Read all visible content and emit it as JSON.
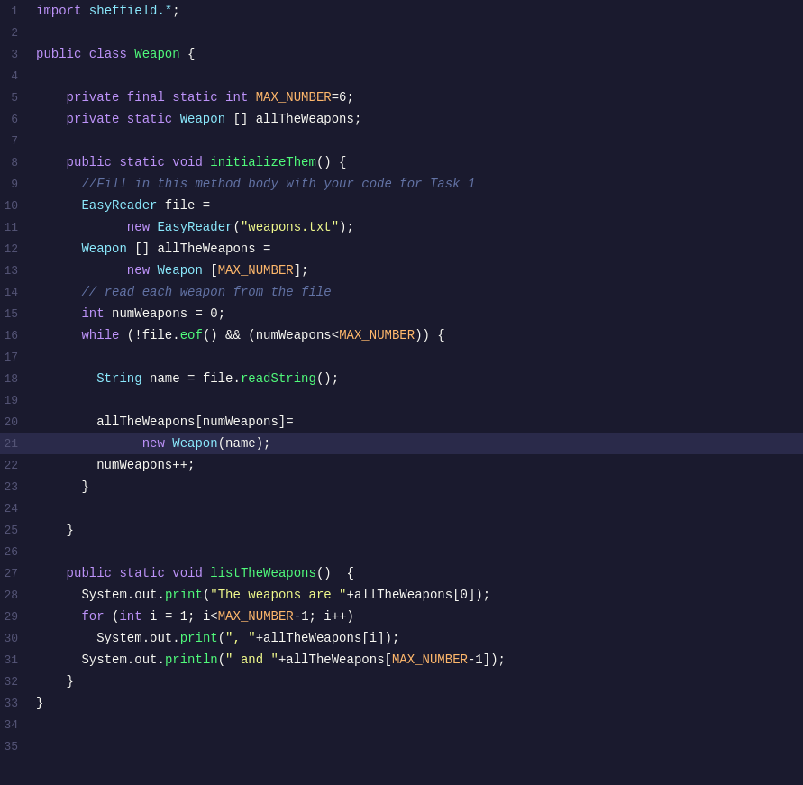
{
  "editor": {
    "background": "#1a1a2e",
    "highlighted_line": 21,
    "lines": [
      {
        "num": 1,
        "tokens": [
          {
            "t": "kw",
            "v": "import"
          },
          {
            "t": "plain",
            "v": " "
          },
          {
            "t": "import-pkg",
            "v": "sheffield.*"
          },
          {
            "t": "plain",
            "v": ";"
          }
        ]
      },
      {
        "num": 2,
        "tokens": []
      },
      {
        "num": 3,
        "tokens": [
          {
            "t": "kw",
            "v": "public"
          },
          {
            "t": "plain",
            "v": " "
          },
          {
            "t": "kw",
            "v": "class"
          },
          {
            "t": "plain",
            "v": " "
          },
          {
            "t": "classname",
            "v": "Weapon"
          },
          {
            "t": "plain",
            "v": " {"
          }
        ]
      },
      {
        "num": 4,
        "tokens": []
      },
      {
        "num": 5,
        "tokens": [
          {
            "t": "plain",
            "v": "    "
          },
          {
            "t": "kw",
            "v": "private"
          },
          {
            "t": "plain",
            "v": " "
          },
          {
            "t": "kw",
            "v": "final"
          },
          {
            "t": "plain",
            "v": " "
          },
          {
            "t": "kw",
            "v": "static"
          },
          {
            "t": "plain",
            "v": " "
          },
          {
            "t": "kw",
            "v": "int"
          },
          {
            "t": "plain",
            "v": " "
          },
          {
            "t": "param",
            "v": "MAX_NUMBER"
          },
          {
            "t": "plain",
            "v": "=6;"
          }
        ]
      },
      {
        "num": 6,
        "tokens": [
          {
            "t": "plain",
            "v": "    "
          },
          {
            "t": "kw",
            "v": "private"
          },
          {
            "t": "plain",
            "v": " "
          },
          {
            "t": "kw",
            "v": "static"
          },
          {
            "t": "plain",
            "v": " "
          },
          {
            "t": "type",
            "v": "Weapon"
          },
          {
            "t": "plain",
            "v": " [] "
          },
          {
            "t": "var",
            "v": "allTheWeapons"
          },
          {
            "t": "plain",
            "v": ";"
          }
        ]
      },
      {
        "num": 7,
        "tokens": []
      },
      {
        "num": 8,
        "tokens": [
          {
            "t": "plain",
            "v": "    "
          },
          {
            "t": "kw",
            "v": "public"
          },
          {
            "t": "plain",
            "v": " "
          },
          {
            "t": "kw",
            "v": "static"
          },
          {
            "t": "plain",
            "v": " "
          },
          {
            "t": "kw",
            "v": "void"
          },
          {
            "t": "plain",
            "v": " "
          },
          {
            "t": "method",
            "v": "initializeThem"
          },
          {
            "t": "plain",
            "v": "() {"
          }
        ]
      },
      {
        "num": 9,
        "tokens": [
          {
            "t": "plain",
            "v": "      "
          },
          {
            "t": "comment",
            "v": "//Fill in this method body with your code for Task 1"
          }
        ]
      },
      {
        "num": 10,
        "tokens": [
          {
            "t": "plain",
            "v": "      "
          },
          {
            "t": "type",
            "v": "EasyReader"
          },
          {
            "t": "plain",
            "v": " "
          },
          {
            "t": "var",
            "v": "file"
          },
          {
            "t": "plain",
            "v": " ="
          }
        ]
      },
      {
        "num": 11,
        "tokens": [
          {
            "t": "plain",
            "v": "            "
          },
          {
            "t": "kw",
            "v": "new"
          },
          {
            "t": "plain",
            "v": " "
          },
          {
            "t": "type",
            "v": "EasyReader"
          },
          {
            "t": "plain",
            "v": "("
          },
          {
            "t": "string",
            "v": "\"weapons.txt\""
          },
          {
            "t": "plain",
            "v": ");"
          }
        ]
      },
      {
        "num": 12,
        "tokens": [
          {
            "t": "plain",
            "v": "      "
          },
          {
            "t": "type",
            "v": "Weapon"
          },
          {
            "t": "plain",
            "v": " [] "
          },
          {
            "t": "var",
            "v": "allTheWeapons"
          },
          {
            "t": "plain",
            "v": " ="
          }
        ]
      },
      {
        "num": 13,
        "tokens": [
          {
            "t": "plain",
            "v": "            "
          },
          {
            "t": "kw",
            "v": "new"
          },
          {
            "t": "plain",
            "v": " "
          },
          {
            "t": "type",
            "v": "Weapon"
          },
          {
            "t": "plain",
            "v": " ["
          },
          {
            "t": "param",
            "v": "MAX_NUMBER"
          },
          {
            "t": "plain",
            "v": "];"
          }
        ]
      },
      {
        "num": 14,
        "tokens": [
          {
            "t": "plain",
            "v": "      "
          },
          {
            "t": "comment",
            "v": "// read each weapon from the file"
          }
        ]
      },
      {
        "num": 15,
        "tokens": [
          {
            "t": "plain",
            "v": "      "
          },
          {
            "t": "kw",
            "v": "int"
          },
          {
            "t": "plain",
            "v": " "
          },
          {
            "t": "var",
            "v": "numWeapons"
          },
          {
            "t": "plain",
            "v": " = 0;"
          }
        ]
      },
      {
        "num": 16,
        "tokens": [
          {
            "t": "plain",
            "v": "      "
          },
          {
            "t": "kw",
            "v": "while"
          },
          {
            "t": "plain",
            "v": " (!"
          },
          {
            "t": "var",
            "v": "file"
          },
          {
            "t": "plain",
            "v": "."
          },
          {
            "t": "method",
            "v": "eof"
          },
          {
            "t": "plain",
            "v": "() && ("
          },
          {
            "t": "var",
            "v": "numWeapons"
          },
          {
            "t": "plain",
            "v": "<"
          },
          {
            "t": "param",
            "v": "MAX_NUMBER"
          },
          {
            "t": "plain",
            "v": ")) {"
          }
        ]
      },
      {
        "num": 17,
        "tokens": []
      },
      {
        "num": 18,
        "tokens": [
          {
            "t": "plain",
            "v": "        "
          },
          {
            "t": "type",
            "v": "String"
          },
          {
            "t": "plain",
            "v": " "
          },
          {
            "t": "var",
            "v": "name"
          },
          {
            "t": "plain",
            "v": " = "
          },
          {
            "t": "var",
            "v": "file"
          },
          {
            "t": "plain",
            "v": "."
          },
          {
            "t": "method",
            "v": "readString"
          },
          {
            "t": "plain",
            "v": "();"
          }
        ]
      },
      {
        "num": 19,
        "tokens": []
      },
      {
        "num": 20,
        "tokens": [
          {
            "t": "plain",
            "v": "        "
          },
          {
            "t": "var",
            "v": "allTheWeapons"
          },
          {
            "t": "plain",
            "v": "["
          },
          {
            "t": "var",
            "v": "numWeapons"
          },
          {
            "t": "plain",
            "v": "]="
          }
        ]
      },
      {
        "num": 21,
        "tokens": [
          {
            "t": "plain",
            "v": "              "
          },
          {
            "t": "kw",
            "v": "new"
          },
          {
            "t": "plain",
            "v": " "
          },
          {
            "t": "type",
            "v": "Weapon"
          },
          {
            "t": "plain",
            "v": "("
          },
          {
            "t": "var",
            "v": "name"
          },
          {
            "t": "plain",
            "v": ");"
          }
        ],
        "highlighted": true
      },
      {
        "num": 22,
        "tokens": [
          {
            "t": "plain",
            "v": "        "
          },
          {
            "t": "var",
            "v": "numWeapons"
          },
          {
            "t": "plain",
            "v": "++;"
          }
        ]
      },
      {
        "num": 23,
        "tokens": [
          {
            "t": "plain",
            "v": "      }"
          }
        ]
      },
      {
        "num": 24,
        "tokens": []
      },
      {
        "num": 25,
        "tokens": [
          {
            "t": "plain",
            "v": "    }"
          }
        ]
      },
      {
        "num": 26,
        "tokens": []
      },
      {
        "num": 27,
        "tokens": [
          {
            "t": "plain",
            "v": "    "
          },
          {
            "t": "kw",
            "v": "public"
          },
          {
            "t": "plain",
            "v": " "
          },
          {
            "t": "kw",
            "v": "static"
          },
          {
            "t": "plain",
            "v": " "
          },
          {
            "t": "kw",
            "v": "void"
          },
          {
            "t": "plain",
            "v": " "
          },
          {
            "t": "method",
            "v": "listTheWeapons"
          },
          {
            "t": "plain",
            "v": "()  {"
          }
        ]
      },
      {
        "num": 28,
        "tokens": [
          {
            "t": "plain",
            "v": "      "
          },
          {
            "t": "var",
            "v": "System"
          },
          {
            "t": "plain",
            "v": "."
          },
          {
            "t": "var",
            "v": "out"
          },
          {
            "t": "plain",
            "v": "."
          },
          {
            "t": "method",
            "v": "print"
          },
          {
            "t": "plain",
            "v": "("
          },
          {
            "t": "string",
            "v": "\"The weapons are \""
          },
          {
            "t": "plain",
            "v": "+"
          },
          {
            "t": "var",
            "v": "allTheWeapons"
          },
          {
            "t": "plain",
            "v": "[0]);"
          }
        ]
      },
      {
        "num": 29,
        "tokens": [
          {
            "t": "plain",
            "v": "      "
          },
          {
            "t": "kw",
            "v": "for"
          },
          {
            "t": "plain",
            "v": " ("
          },
          {
            "t": "kw",
            "v": "int"
          },
          {
            "t": "plain",
            "v": " "
          },
          {
            "t": "var",
            "v": "i"
          },
          {
            "t": "plain",
            "v": " = 1; "
          },
          {
            "t": "var",
            "v": "i"
          },
          {
            "t": "plain",
            "v": "<"
          },
          {
            "t": "param",
            "v": "MAX_NUMBER"
          },
          {
            "t": "plain",
            "v": "-1; "
          },
          {
            "t": "var",
            "v": "i"
          },
          {
            "t": "plain",
            "v": "++)"
          }
        ]
      },
      {
        "num": 30,
        "tokens": [
          {
            "t": "plain",
            "v": "        "
          },
          {
            "t": "var",
            "v": "System"
          },
          {
            "t": "plain",
            "v": "."
          },
          {
            "t": "var",
            "v": "out"
          },
          {
            "t": "plain",
            "v": "."
          },
          {
            "t": "method",
            "v": "print"
          },
          {
            "t": "plain",
            "v": "("
          },
          {
            "t": "string",
            "v": "\", \""
          },
          {
            "t": "plain",
            "v": "+"
          },
          {
            "t": "var",
            "v": "allTheWeapons"
          },
          {
            "t": "plain",
            "v": "["
          },
          {
            "t": "var",
            "v": "i"
          },
          {
            "t": "plain",
            "v": "]);"
          }
        ]
      },
      {
        "num": 31,
        "tokens": [
          {
            "t": "plain",
            "v": "      "
          },
          {
            "t": "var",
            "v": "System"
          },
          {
            "t": "plain",
            "v": "."
          },
          {
            "t": "var",
            "v": "out"
          },
          {
            "t": "plain",
            "v": "."
          },
          {
            "t": "method",
            "v": "println"
          },
          {
            "t": "plain",
            "v": "("
          },
          {
            "t": "string",
            "v": "\" and \""
          },
          {
            "t": "plain",
            "v": "+"
          },
          {
            "t": "var",
            "v": "allTheWeapons"
          },
          {
            "t": "plain",
            "v": "["
          },
          {
            "t": "param",
            "v": "MAX_NUMBER"
          },
          {
            "t": "plain",
            "v": "-1]);"
          }
        ]
      },
      {
        "num": 32,
        "tokens": [
          {
            "t": "plain",
            "v": "    }"
          }
        ]
      },
      {
        "num": 33,
        "tokens": [
          {
            "t": "plain",
            "v": "}"
          }
        ]
      },
      {
        "num": 34,
        "tokens": []
      },
      {
        "num": 35,
        "tokens": []
      }
    ]
  }
}
